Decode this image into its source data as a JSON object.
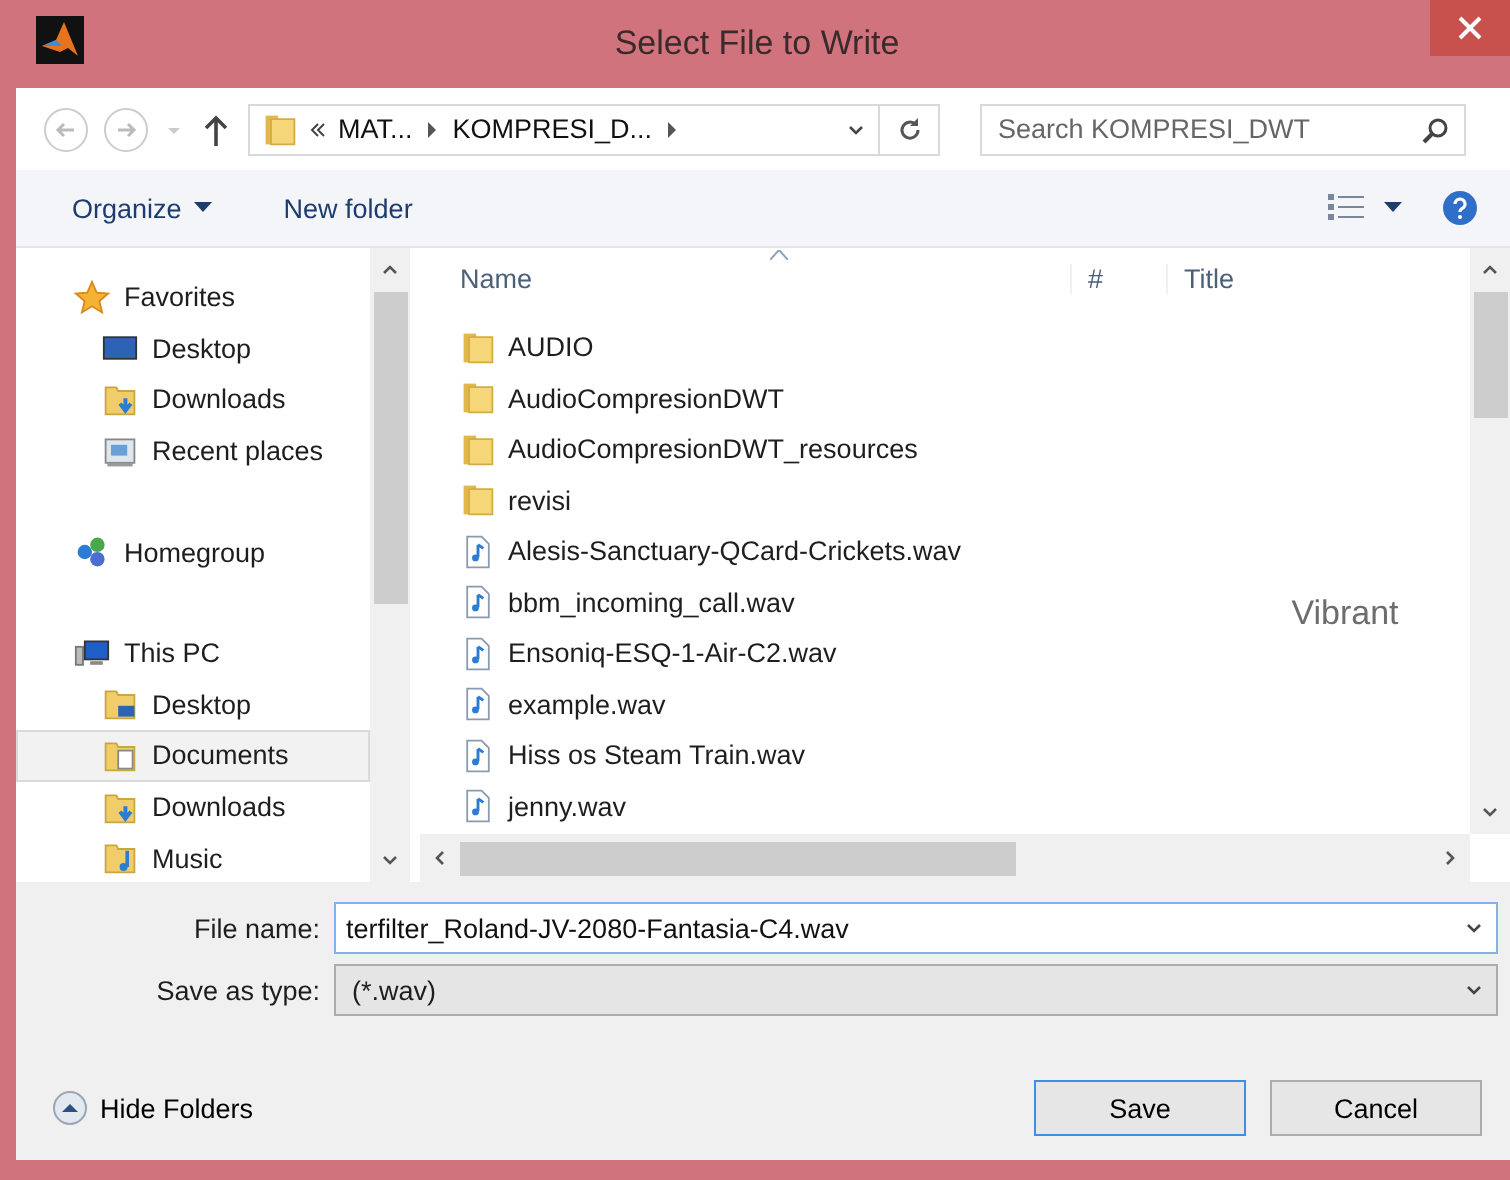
{
  "window": {
    "title": "Select File to Write"
  },
  "address": {
    "crumbs": [
      "MAT...",
      "KOMPRESI_D..."
    ]
  },
  "search": {
    "placeholder": "Search KOMPRESI_DWT"
  },
  "toolbar": {
    "organize": "Organize",
    "new_folder": "New folder"
  },
  "sidebar": {
    "sections": [
      {
        "label": "Favorites",
        "selected": false,
        "items": [
          {
            "label": "Desktop",
            "selected": false
          },
          {
            "label": "Downloads",
            "selected": false
          },
          {
            "label": "Recent places",
            "selected": false
          }
        ]
      },
      {
        "label": "Homegroup",
        "selected": false
      },
      {
        "label": "This PC",
        "selected": false,
        "items": [
          {
            "label": "Desktop",
            "selected": false
          },
          {
            "label": "Documents",
            "selected": true
          },
          {
            "label": "Downloads",
            "selected": false
          },
          {
            "label": "Music",
            "selected": false
          }
        ]
      }
    ]
  },
  "table": {
    "columns": [
      "Name",
      "#",
      "Title"
    ],
    "rows": [
      {
        "kind": "folder",
        "name": "AUDIO"
      },
      {
        "kind": "folder",
        "name": "AudioCompresionDWT"
      },
      {
        "kind": "folder",
        "name": "AudioCompresionDWT_resources"
      },
      {
        "kind": "folder",
        "name": "revisi"
      },
      {
        "kind": "audio",
        "name": "Alesis-Sanctuary-QCard-Crickets.wav"
      },
      {
        "kind": "audio",
        "name": "bbm_incoming_call.wav",
        "title": "Vibrant"
      },
      {
        "kind": "audio",
        "name": "Ensoniq-ESQ-1-Air-C2.wav"
      },
      {
        "kind": "audio",
        "name": "example.wav"
      },
      {
        "kind": "audio",
        "name": "Hiss os Steam Train.wav"
      },
      {
        "kind": "audio",
        "name": "jenny.wav"
      }
    ]
  },
  "form": {
    "file_name_label": "File name:",
    "file_name": "terfilter_Roland-JV-2080-Fantasia-C4.wav",
    "type_label": "Save as type:",
    "type": "(*.wav)"
  },
  "hide_folders": "Hide Folders",
  "buttons": [
    {
      "label": "Save",
      "default": true
    },
    {
      "label": "Cancel",
      "default": false
    }
  ]
}
